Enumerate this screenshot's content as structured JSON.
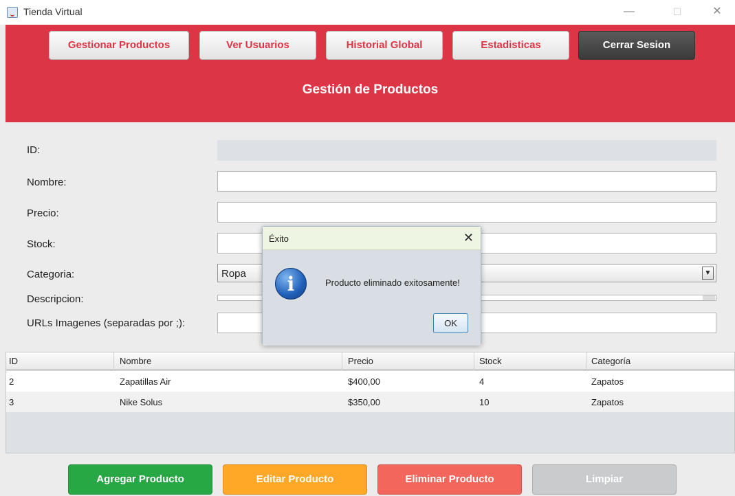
{
  "window": {
    "title": "Tienda Virtual",
    "minimize": "—",
    "maximize": "☐",
    "close": "✕"
  },
  "nav": {
    "gestionar": "Gestionar Productos",
    "usuarios": "Ver Usuarios",
    "historial": "Historial Global",
    "estadisticas": "Estadisticas",
    "cerrar": "Cerrar Sesion"
  },
  "header": {
    "title": "Gestión de Productos"
  },
  "form": {
    "id_label": "ID:",
    "nombre_label": "Nombre:",
    "precio_label": "Precio:",
    "stock_label": "Stock:",
    "categoria_label": "Categoria:",
    "categoria_value": "Ropa",
    "descripcion_label": "Descripcion:",
    "urls_label": "URLs Imagenes (separadas por ;):"
  },
  "table": {
    "headers": [
      "ID",
      "Nombre",
      "Precio",
      "Stock",
      "Categoría"
    ],
    "rows": [
      [
        "2",
        "Zapatillas Air",
        "$400,00",
        "4",
        "Zapatos"
      ],
      [
        "3",
        "Nike Solus",
        "$350,00",
        "10",
        "Zapatos"
      ]
    ]
  },
  "actions": {
    "agregar": "Agregar Producto",
    "editar": "Editar Producto",
    "eliminar": "Eliminar Producto",
    "limpiar": "Limpiar"
  },
  "dialog": {
    "title": "Éxito",
    "close": "✕",
    "icon": "info-icon",
    "icon_glyph": "i",
    "message": "Producto eliminado exitosamente!",
    "ok": "OK"
  },
  "colors": {
    "header": "#dc3545",
    "agregar": "#28a745",
    "editar": "#ffa726",
    "eliminar": "#f2665b",
    "limpiar": "#c9cbcd"
  }
}
